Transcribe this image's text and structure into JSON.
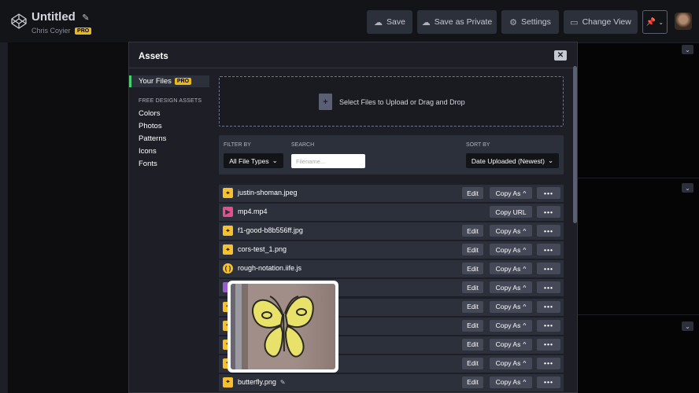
{
  "topbar": {
    "title": "Untitled",
    "author": "Chris Coyier",
    "pro": "PRO",
    "buttons": {
      "save": "Save",
      "save_private": "Save as Private",
      "settings": "Settings",
      "change_view": "Change View"
    }
  },
  "modal": {
    "title": "Assets",
    "close": "✕",
    "nav": {
      "your_files": "Your Files",
      "pro": "PRO",
      "section": "FREE DESIGN ASSETS",
      "items": [
        "Colors",
        "Photos",
        "Patterns",
        "Icons",
        "Fonts"
      ]
    },
    "dropzone": "Select Files to Upload or Drag and Drop",
    "filter": {
      "filter_by_label": "FILTER BY",
      "filter_value": "All File Types",
      "search_label": "SEARCH",
      "search_placeholder": "Filename...",
      "sort_label": "SORT BY",
      "sort_value": "Date Uploaded (Newest)"
    },
    "buttons": {
      "edit": "Edit",
      "copy_as": "Copy As",
      "copy_url": "Copy URL",
      "more": "•••"
    },
    "files": [
      {
        "name": "justin-shoman.jpeg",
        "type": "image"
      },
      {
        "name": "mp4.mp4",
        "type": "video"
      },
      {
        "name": "f1-good-b8b556ff.jpg",
        "type": "image"
      },
      {
        "name": "cors-test_1.png",
        "type": "image"
      },
      {
        "name": "rough-notation.iife.js",
        "type": "js"
      },
      {
        "name": "",
        "type": "other"
      },
      {
        "name": "",
        "type": "image"
      },
      {
        "name": "",
        "type": "image"
      },
      {
        "name": "",
        "type": "image"
      },
      {
        "name": "",
        "type": "image"
      },
      {
        "name": "butterfly.png",
        "type": "image"
      }
    ]
  },
  "colors": {
    "accent_green": "#47cf73",
    "pro_yellow": "#e8b822",
    "image_icon": "#f7c02f",
    "video_icon": "#e74e8d",
    "js_icon": "#f7c02f",
    "other_icon": "#9c5cd0"
  },
  "icons": {
    "logo": "codepen-logo-icon",
    "cloud": "cloud-icon",
    "gear": "gear-icon",
    "layout": "layout-icon",
    "pin": "pin-icon",
    "chevron": "chevron-down-icon",
    "caret_up": "caret-up-icon",
    "pencil": "pencil-icon"
  }
}
